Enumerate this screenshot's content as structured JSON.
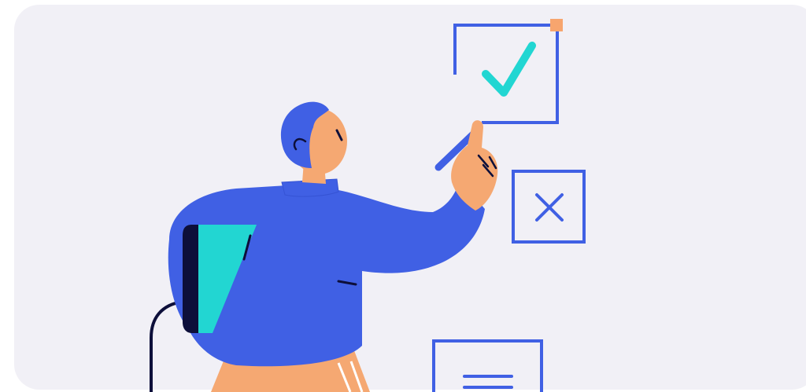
{
  "illustration": {
    "subject": "person-checking-checklist",
    "icons": [
      "check-mark-icon",
      "cross-mark-icon",
      "text-lines-icon"
    ],
    "colors": {
      "background": "#f1f0f6",
      "primary_blue": "#4060e4",
      "skin": "#f5a872",
      "teal": "#22d6d2",
      "navy": "#0d0f3a",
      "accent_orange": "#f7a56e"
    }
  }
}
